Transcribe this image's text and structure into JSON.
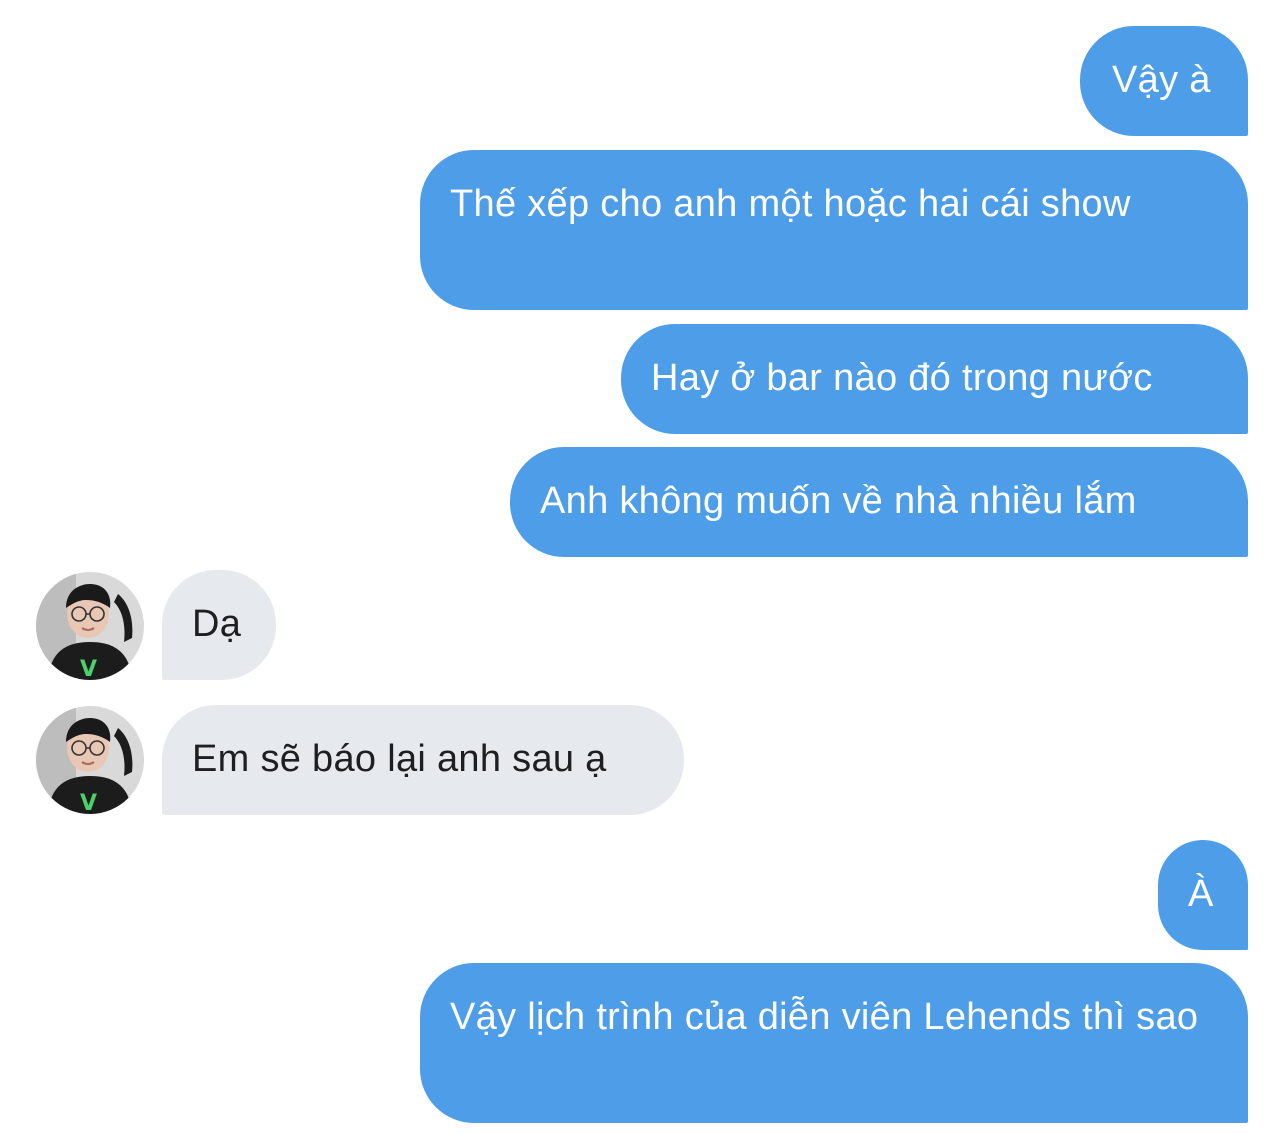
{
  "colors": {
    "outgoing_bubble": "#4e9de8",
    "incoming_bubble": "#e6eaef",
    "outgoing_text": "#ffffff",
    "incoming_text": "#1e1f21"
  },
  "messages": [
    {
      "direction": "outgoing",
      "text": "Vậy à"
    },
    {
      "direction": "outgoing",
      "text": "Thế xếp cho anh một hoặc hai cái show"
    },
    {
      "direction": "outgoing",
      "text": "Hay ở bar nào đó trong nước"
    },
    {
      "direction": "outgoing",
      "text": "Anh không muốn về nhà nhiều lắm"
    },
    {
      "direction": "incoming",
      "text": "Dạ",
      "avatar": "contact-avatar"
    },
    {
      "direction": "incoming",
      "text": "Em sẽ báo lại anh sau ạ",
      "avatar": "contact-avatar"
    },
    {
      "direction": "outgoing",
      "text": "À"
    },
    {
      "direction": "outgoing",
      "text": "Vậy lịch trình của diễn viên Lehends thì sao"
    }
  ]
}
